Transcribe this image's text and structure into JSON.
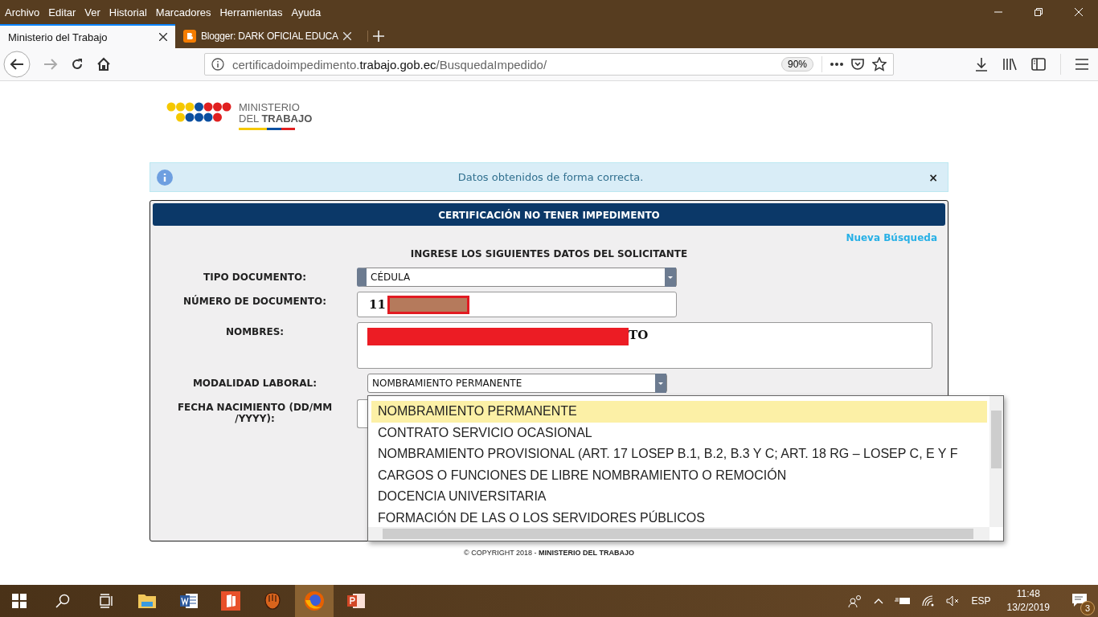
{
  "menu": [
    "Archivo",
    "Editar",
    "Ver",
    "Historial",
    "Marcadores",
    "Herramientas",
    "Ayuda"
  ],
  "tabs": [
    {
      "title": "Ministerio del Trabajo",
      "selected": true
    },
    {
      "title": "Blogger: DARK OFICIAL EDUCA",
      "selected": false
    }
  ],
  "address_bar": {
    "url_sub": "certificadoimpedimento.",
    "url_domain": "trabajo.gob.ec",
    "url_path": "/BusquedaImpedido/",
    "zoom": "90%"
  },
  "logo": {
    "line1": "MINISTERIO",
    "line2_light": "DEL",
    "line2_bold": "TRABAJO"
  },
  "alert": {
    "message": "Datos obtenidos de forma correcta.",
    "close": "×"
  },
  "panel": {
    "title": "CERTIFICACIÓN NO TENER IMPEDIMENTO",
    "link": "Nueva Búsqueda",
    "subtitle": "INGRESE LOS SIGUIENTES DATOS DEL SOLICITANTE",
    "fields": [
      {
        "kind": "select",
        "label": "TIPO DOCUMENTO:",
        "value": "CÉDULA",
        "expanded": false
      },
      {
        "kind": "text",
        "label": "NÚMERO DE DOCUMENTO:",
        "value": "11",
        "redacted": true
      },
      {
        "kind": "textarea",
        "label": "NOMBRES:",
        "value": "TO",
        "redacted": true
      },
      {
        "kind": "select",
        "label": "MODALIDAD LABORAL:",
        "value": "NOMBRAMIENTO PERMANENTE",
        "expanded": true
      },
      {
        "kind": "date",
        "label": "FECHA NACIMIENTO (DD/MM /YYYY):"
      }
    ],
    "options": [
      {
        "label": "NOMBRAMIENTO PERMANENTE",
        "selected": true
      },
      {
        "label": "CONTRATO SERVICIO OCASIONAL",
        "selected": false
      },
      {
        "label": "NOMBRAMIENTO PROVISIONAL (ART. 17 LOSEP B.1, B.2, B.3 Y C; ART. 18 RG – LOSEP C, E Y F",
        "selected": false
      },
      {
        "label": "CARGOS O FUNCIONES DE LIBRE NOMBRAMIENTO O REMOCIÓN",
        "selected": false
      },
      {
        "label": "DOCENCIA UNIVERSITARIA",
        "selected": false
      },
      {
        "label": "FORMACIÓN DE LAS O LOS SERVIDORES PÚBLICOS",
        "selected": false
      }
    ]
  },
  "footer": {
    "copyright": "© COPYRIGHT 2018 - ",
    "owner": "MINISTERIO DEL TRABAJO"
  },
  "taskbar": {
    "apps": [
      {
        "kind": "folder",
        "active": false
      },
      {
        "kind": "word",
        "active": false
      },
      {
        "kind": "pdf",
        "active": false
      },
      {
        "kind": "glove",
        "active": false
      },
      {
        "kind": "firefox",
        "active": true
      },
      {
        "kind": "powerpoint",
        "active": false
      }
    ],
    "language": "ESP",
    "time": "11:48",
    "date": "13/2/2019",
    "notifications": "3"
  }
}
